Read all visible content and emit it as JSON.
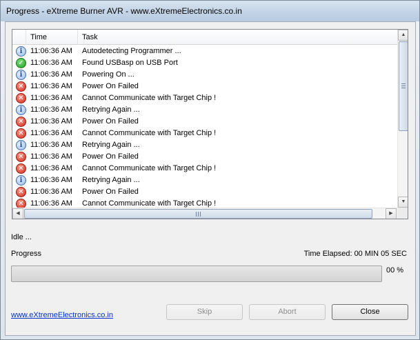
{
  "window": {
    "title": "Progress - eXtreme Burner AVR - www.eXtremeElectronics.co.in"
  },
  "log": {
    "columns": {
      "time": "Time",
      "task": "Task"
    },
    "rows": [
      {
        "icon": "info-icon",
        "time": "11:06:36 AM",
        "task": "Autodetecting Programmer ..."
      },
      {
        "icon": "success-check-icon",
        "time": "11:06:36 AM",
        "task": "Found USBasp on USB Port"
      },
      {
        "icon": "info-icon",
        "time": "11:06:36 AM",
        "task": "Powering On ..."
      },
      {
        "icon": "error-icon",
        "time": "11:06:36 AM",
        "task": "Power On Failed"
      },
      {
        "icon": "error-icon",
        "time": "11:06:36 AM",
        "task": "Cannot Communicate with Target Chip !"
      },
      {
        "icon": "info-icon",
        "time": "11:06:36 AM",
        "task": "Retrying Again ..."
      },
      {
        "icon": "error-icon",
        "time": "11:06:36 AM",
        "task": "Power On Failed"
      },
      {
        "icon": "error-icon",
        "time": "11:06:36 AM",
        "task": "Cannot Communicate with Target Chip !"
      },
      {
        "icon": "info-icon",
        "time": "11:06:36 AM",
        "task": "Retrying Again ..."
      },
      {
        "icon": "error-icon",
        "time": "11:06:36 AM",
        "task": "Power On Failed"
      },
      {
        "icon": "error-icon",
        "time": "11:06:36 AM",
        "task": "Cannot Communicate with Target Chip !"
      },
      {
        "icon": "info-icon",
        "time": "11:06:36 AM",
        "task": "Retrying Again ..."
      },
      {
        "icon": "error-icon",
        "time": "11:06:36 AM",
        "task": "Power On Failed"
      },
      {
        "icon": "error-icon",
        "time": "11:06:36 AM",
        "task": "Cannot Communicate with Target Chip !"
      }
    ]
  },
  "status": {
    "text": "Idle ..."
  },
  "progress": {
    "label": "Progress",
    "elapsed": "Time Elapsed: 00 MIN  05 SEC",
    "percent_text": "00 %",
    "value": 0
  },
  "footer": {
    "link": "www.eXtremeElectronics.co.in",
    "skip_label": "Skip",
    "abort_label": "Abort",
    "close_label": "Close"
  },
  "colors": {
    "info": "#3a6cb5",
    "success": "#1f9b1f",
    "error": "#d0271a",
    "link": "#0033cc"
  }
}
